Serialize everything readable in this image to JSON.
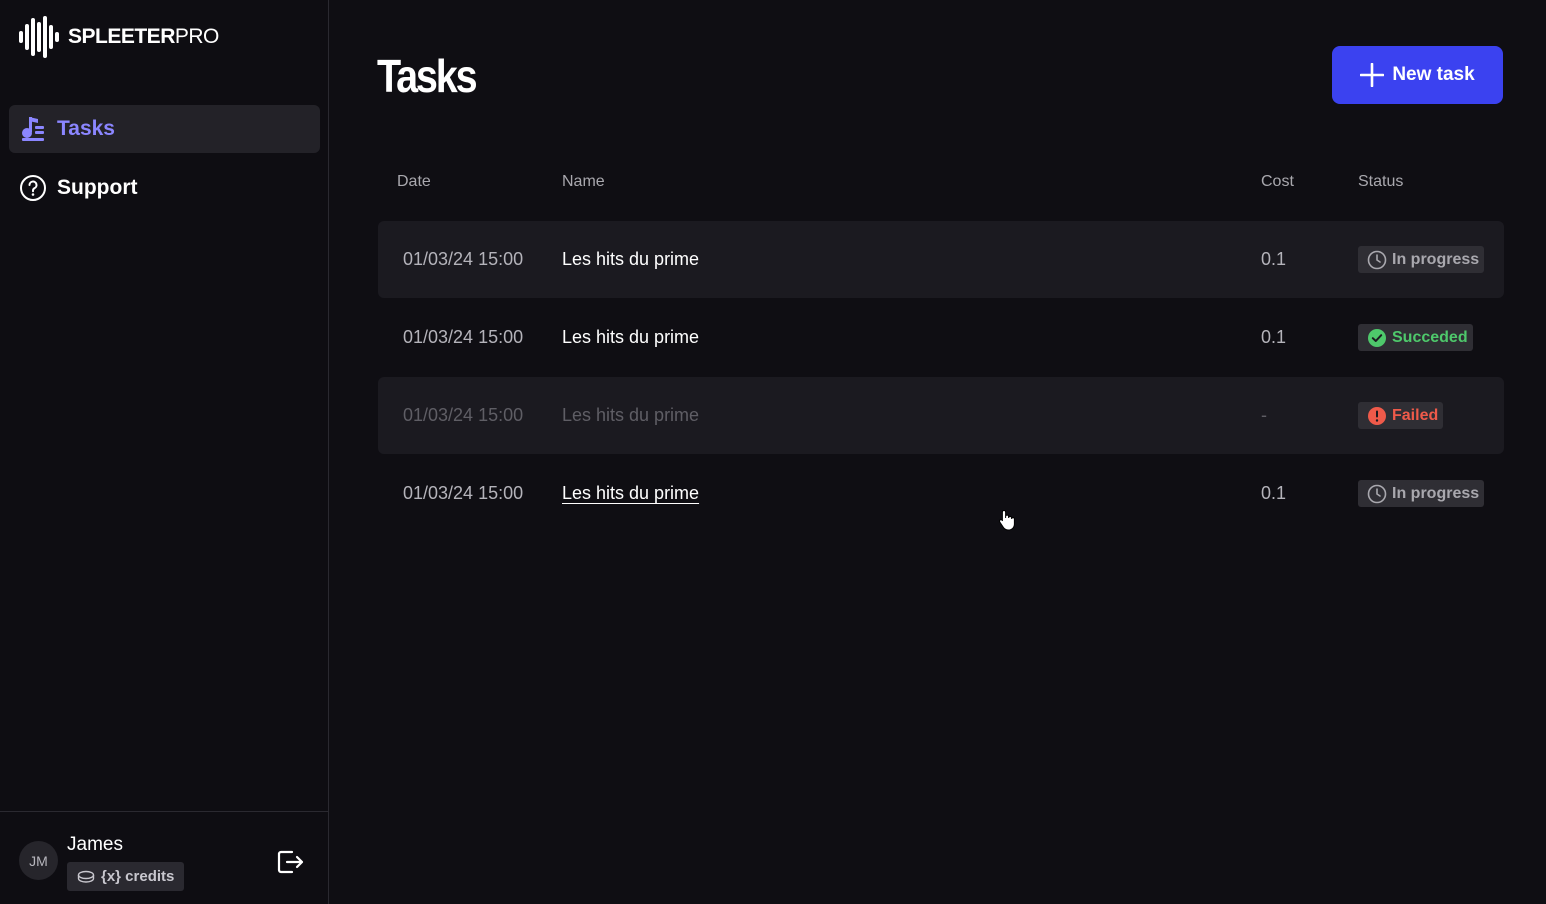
{
  "app": {
    "brand_bold": "SPLEETER",
    "brand_light": "PRO"
  },
  "sidebar": {
    "items": [
      {
        "label": "Tasks",
        "icon": "music-list-icon",
        "active": true
      },
      {
        "label": "Support",
        "icon": "help-circle-icon",
        "active": false
      }
    ]
  },
  "user": {
    "initials": "JM",
    "name": "James",
    "credits": "{x} credits"
  },
  "header": {
    "title": "Tasks",
    "new_task_label": "New task"
  },
  "table": {
    "columns": [
      "Date",
      "Name",
      "Cost",
      "Status"
    ],
    "rows": [
      {
        "date": "01/03/24 15:00",
        "name": "Les hits du prime",
        "cost": "0.1",
        "status": "In progress",
        "status_type": "progress"
      },
      {
        "date": "01/03/24 15:00",
        "name": "Les hits du prime",
        "cost": "0.1",
        "status": "Succeded",
        "status_type": "success"
      },
      {
        "date": "01/03/24 15:00",
        "name": "Les hits du prime",
        "cost": "-",
        "status": "Failed",
        "status_type": "fail"
      },
      {
        "date": "01/03/24 15:00",
        "name": "Les hits du prime",
        "cost": "0.1",
        "status": "In progress",
        "status_type": "progress"
      }
    ]
  },
  "colors": {
    "accent": "#3b42f0",
    "active_nav": "#8b86ff",
    "success": "#4ec86b",
    "failed": "#ef5a4a"
  }
}
